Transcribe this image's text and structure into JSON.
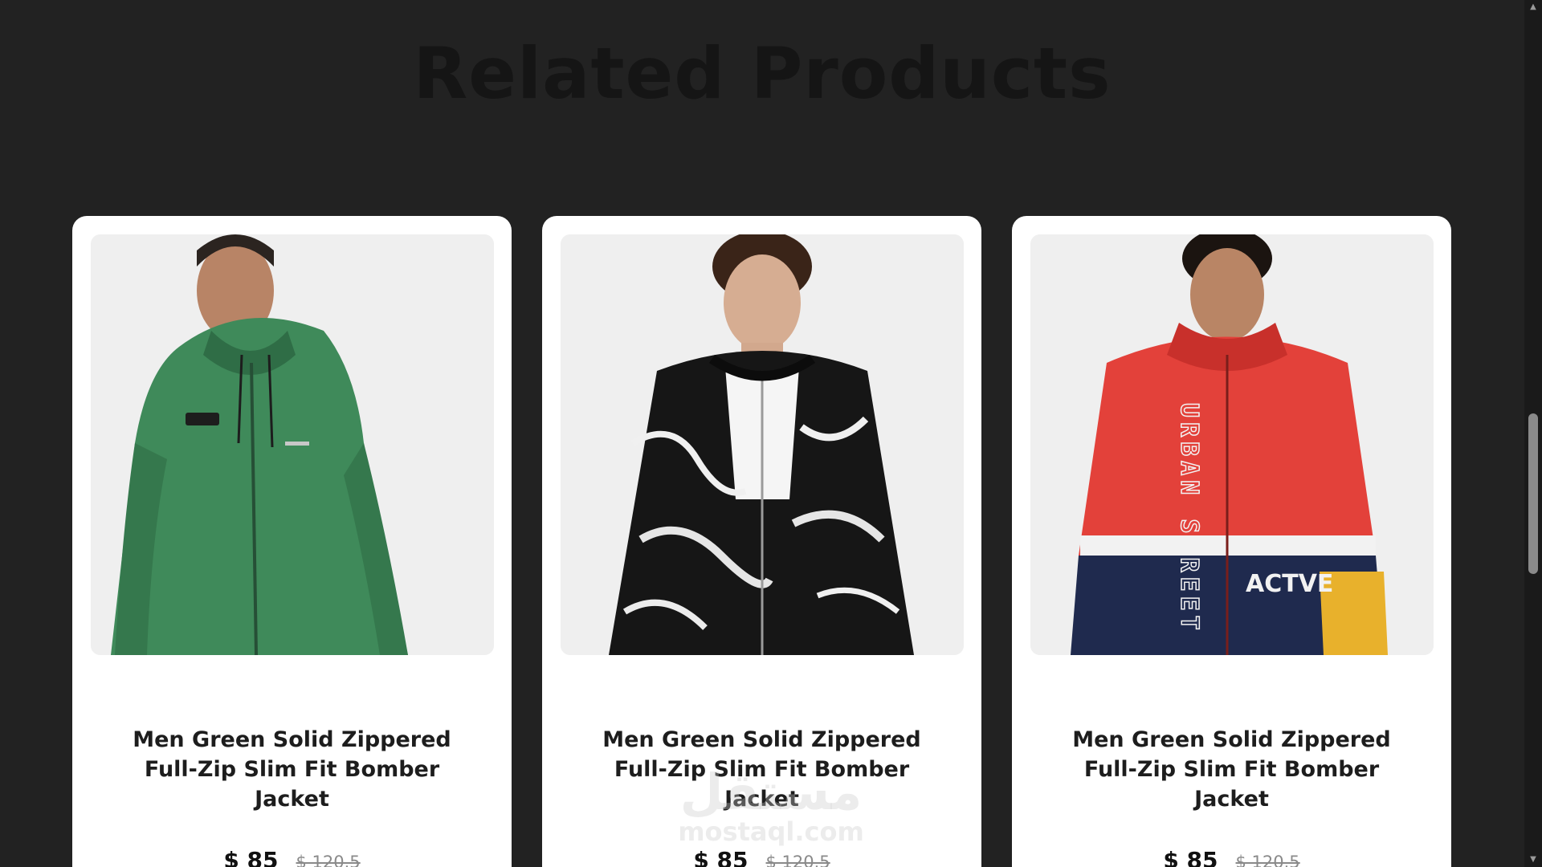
{
  "section": {
    "title": "Related Products"
  },
  "products": [
    {
      "title": "Men Green Solid Zippered Full-Zip Slim Fit Bomber Jacket",
      "price": "$ 85",
      "old_price": "$ 120.5",
      "image_icon": "green-hooded-jacket-photo",
      "jacket_color": "#3f8a5a"
    },
    {
      "title": "Men Green Solid Zippered Full-Zip Slim Fit Bomber Jacket",
      "price": "$ 85",
      "old_price": "$ 120.5",
      "image_icon": "black-white-bomber-jacket-photo",
      "jacket_color": "#1a1a1a"
    },
    {
      "title": "Men Green Solid Zippered Full-Zip Slim Fit Bomber Jacket",
      "price": "$ 85",
      "old_price": "$ 120.5",
      "image_icon": "red-navy-windbreaker-photo",
      "jacket_color": "#e3413a"
    }
  ],
  "watermark": {
    "arabic": "مستقل",
    "latin": "mostaql.com"
  },
  "scrollbar": {
    "up_glyph": "▲",
    "down_glyph": "▼"
  }
}
